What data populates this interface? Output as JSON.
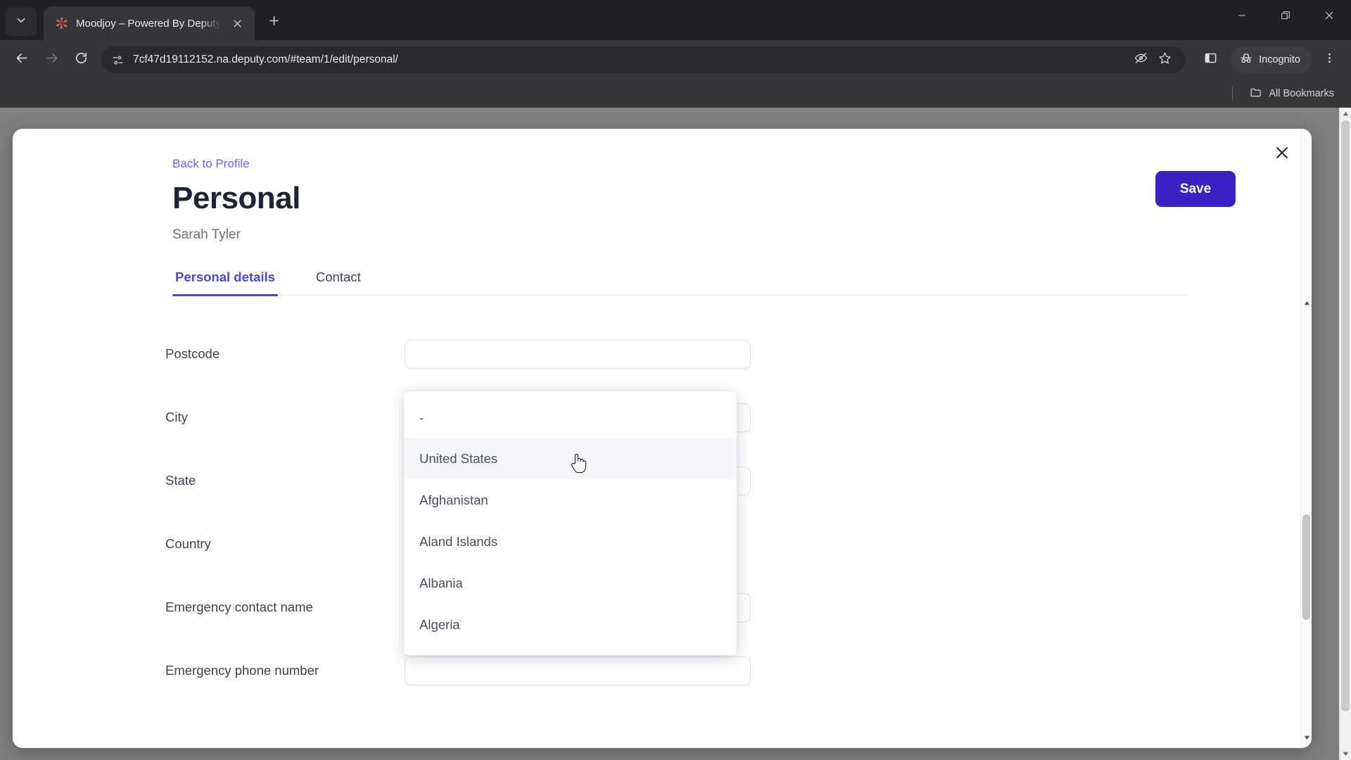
{
  "browser": {
    "tab": {
      "title": "Moodjoy – Powered By Deputy",
      "favicon_name": "moodjoy-favicon"
    },
    "new_tab_label": "+",
    "url": "7cf47d19112152.na.deputy.com/#team/1/edit/personal/",
    "profile_chip_label": "Incognito",
    "bookmarks_label": "All Bookmarks",
    "icons": {
      "tab_search": "chevron-down-icon",
      "tab_close": "close-icon",
      "new_tab": "plus-icon",
      "minimize": "minimize-icon",
      "maximize": "maximize-icon",
      "window_close": "close-icon",
      "back": "back-arrow-icon",
      "forward": "forward-arrow-icon",
      "reload": "reload-icon",
      "site_info": "site-settings-icon",
      "tracking": "eye-off-icon",
      "bookmark": "star-icon",
      "side_panel": "side-panel-icon",
      "incognito": "incognito-icon",
      "menu": "three-dot-menu-icon",
      "bookmarks_folder": "folder-icon"
    }
  },
  "modal": {
    "back_link": "Back to Profile",
    "title": "Personal",
    "subtitle": "Sarah Tyler",
    "save_label": "Save",
    "close_icon": "close-icon",
    "tabs": [
      {
        "label": "Personal details",
        "active": true
      },
      {
        "label": "Contact",
        "active": false
      }
    ],
    "fields": [
      {
        "label": "Postcode",
        "value": "",
        "type": "text"
      },
      {
        "label": "City",
        "value": "",
        "type": "text"
      },
      {
        "label": "State",
        "value": "",
        "type": "text"
      },
      {
        "label": "Country",
        "value": "-",
        "type": "select"
      },
      {
        "label": "Emergency contact name",
        "value": "",
        "type": "text"
      },
      {
        "label": "Emergency phone number",
        "value": "",
        "type": "text"
      }
    ],
    "country_dropdown": {
      "open": true,
      "items": [
        {
          "label": "-",
          "hovered": false
        },
        {
          "label": "United States",
          "hovered": true
        },
        {
          "label": "Afghanistan",
          "hovered": false
        },
        {
          "label": "Aland Islands",
          "hovered": false
        },
        {
          "label": "Albania",
          "hovered": false
        },
        {
          "label": "Algeria",
          "hovered": false
        }
      ]
    }
  },
  "colors": {
    "accent": "#4f46c9",
    "save_button": "#3b21c4",
    "link": "#6e62e5",
    "title": "#1f2334",
    "chrome_bg": "#35363a",
    "backdrop": "#808080"
  }
}
